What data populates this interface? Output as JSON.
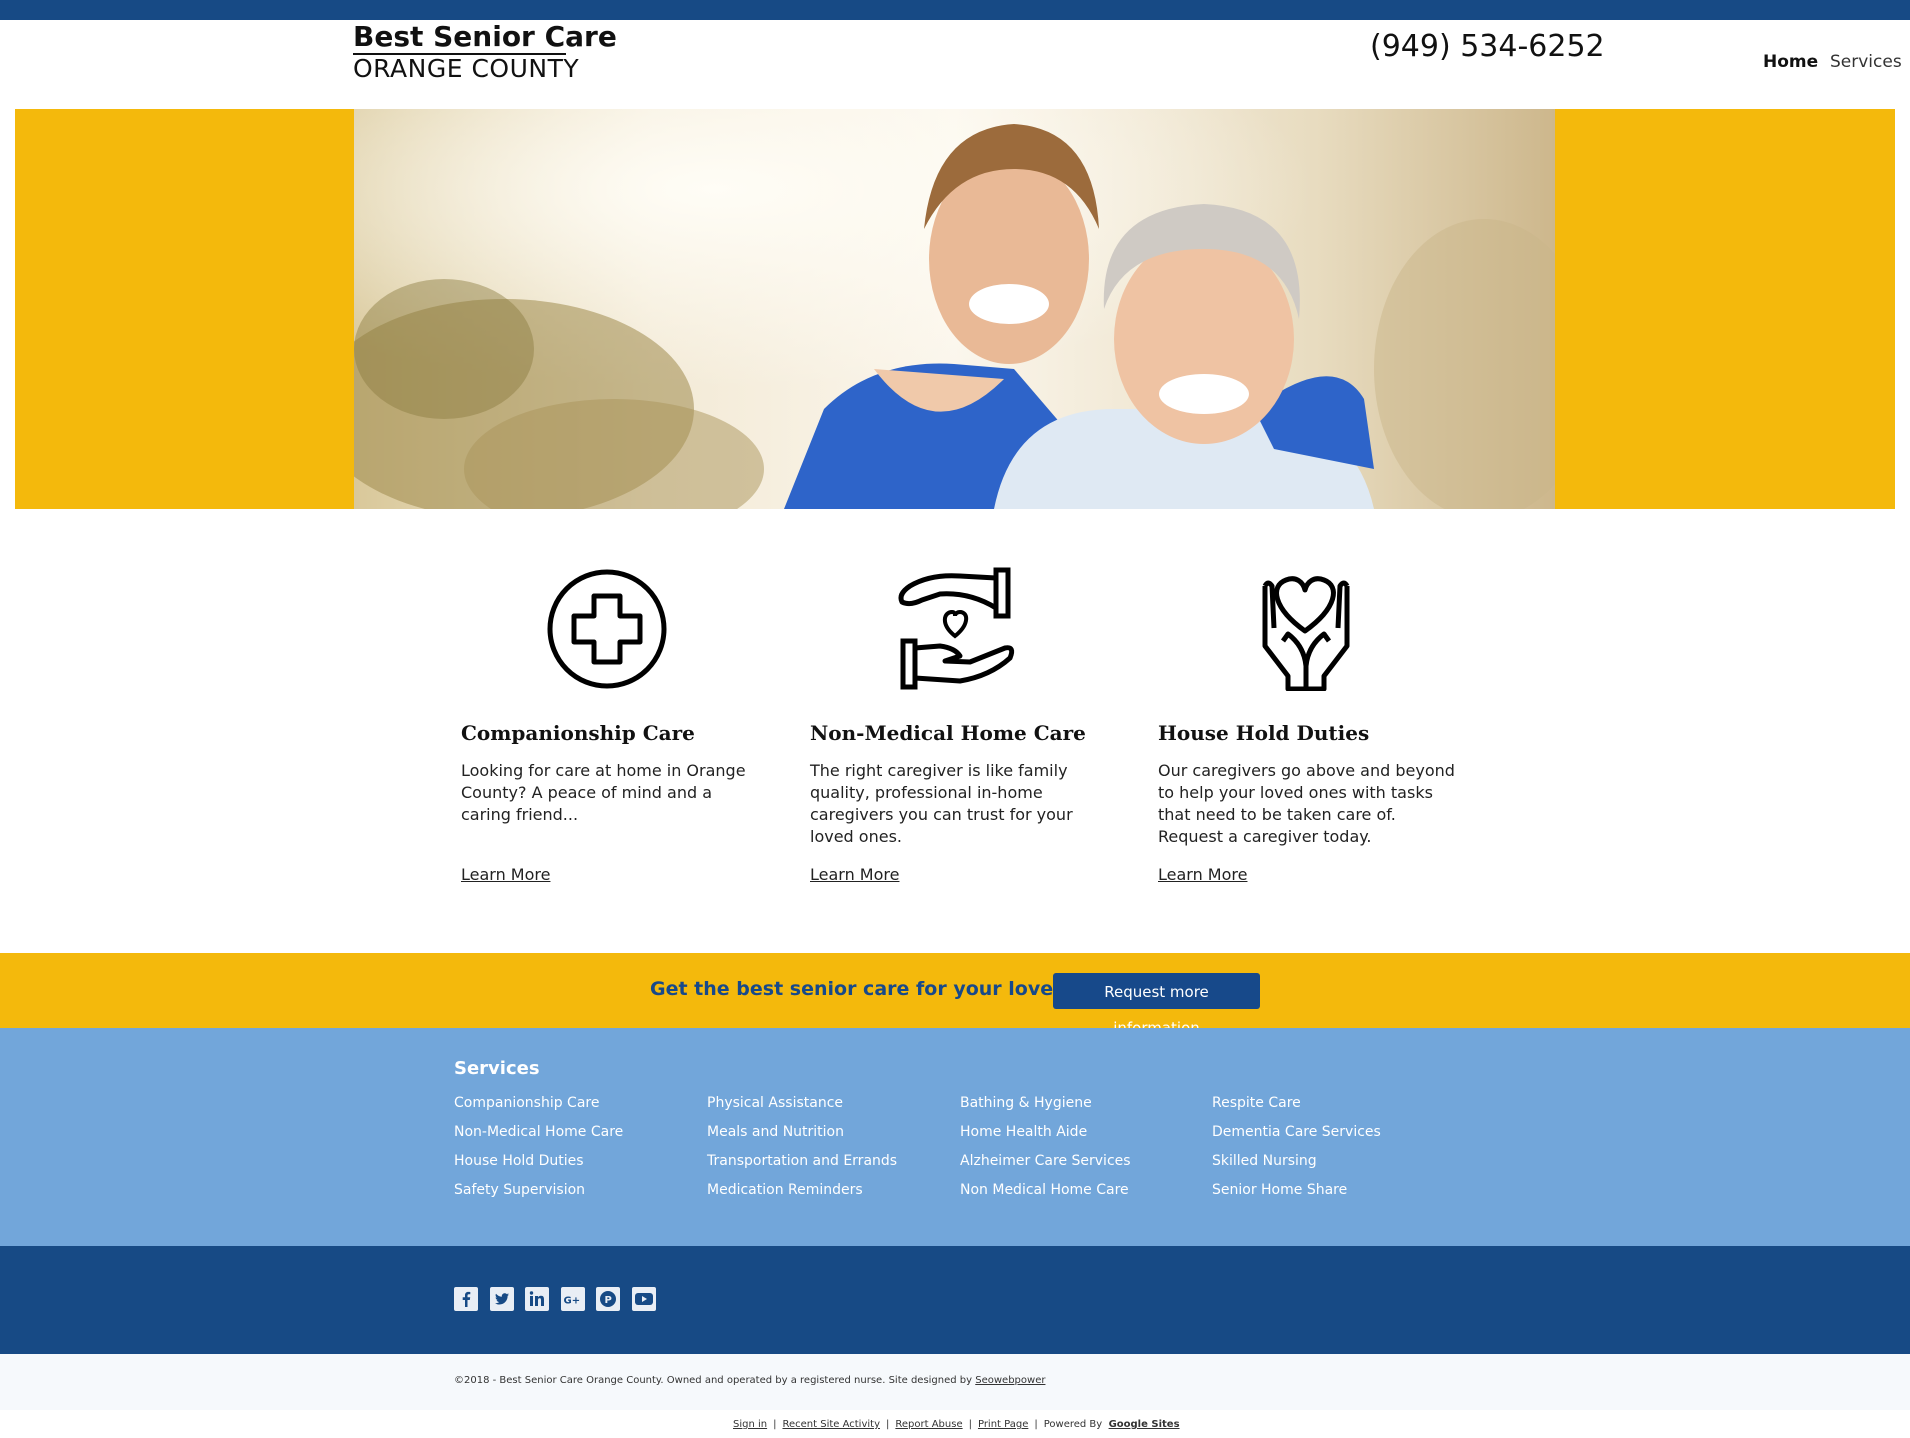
{
  "header": {
    "brand_title": "Best Senior Care",
    "brand_subtitle": "ORANGE COUNTY",
    "phone": "(949) 534-6252",
    "nav": [
      {
        "label": "Home",
        "active": true
      },
      {
        "label": "Services",
        "active": false
      }
    ]
  },
  "hero": {
    "background_color": "#f4b90c",
    "image_description_icon": "hero-photo"
  },
  "features": [
    {
      "icon": "medical-cross-icon",
      "title": "Companionship Care",
      "text": "Looking for care at home in Orange County? A peace of mind and a caring friend...",
      "link": "Learn More"
    },
    {
      "icon": "caring-hands-icon",
      "title": "Non-Medical Home Care",
      "text": "The right caregiver is like family quality, professional in-home caregivers you can trust for your loved ones.",
      "link": "Learn More"
    },
    {
      "icon": "heart-hands-icon",
      "title": "House Hold Duties",
      "text": "Our caregivers go above and beyond to help your loved ones with tasks that need to be taken care of. Request a caregiver today.",
      "link": "Learn More"
    }
  ],
  "cta": {
    "text": "Get the best senior care for your loved one.",
    "button": "Request more information"
  },
  "services": {
    "heading": "Services",
    "columns": [
      [
        "Companionship Care",
        "Non-Medical Home Care",
        "House Hold Duties",
        "Safety Supervision"
      ],
      [
        "Physical Assistance",
        "Meals and Nutrition",
        "Transportation and Errands",
        "Medication Reminders"
      ],
      [
        "Bathing & Hygiene",
        "Home Health Aide",
        "Alzheimer Care Services",
        "Non Medical Home Care"
      ],
      [
        "Respite Care",
        "Dementia Care Services",
        "Skilled Nursing",
        "Senior Home Share"
      ]
    ]
  },
  "social": [
    "facebook-icon",
    "twitter-icon",
    "linkedin-icon",
    "google-plus-icon",
    "pinterest-icon",
    "youtube-icon"
  ],
  "footer": {
    "copyright": "©2018 - Best Senior Care Orange County. Owned and operated by a registered nurse. Site designed by ",
    "designer": "Seowebpower"
  },
  "bottom_links": {
    "sign_in": "Sign in",
    "recent": "Recent Site Activity",
    "report": "Report Abuse",
    "print": "Print Page",
    "powered": "Powered By",
    "google": "Google Sites"
  },
  "colors": {
    "navy": "#174a85",
    "yellow": "#f4b90c",
    "light_blue": "#72a6da"
  }
}
